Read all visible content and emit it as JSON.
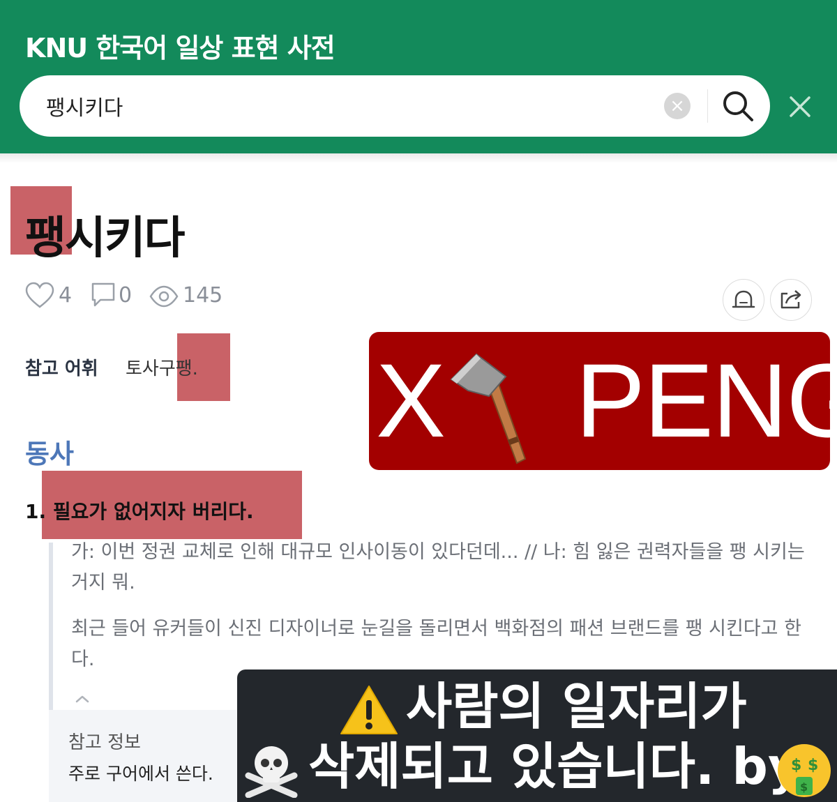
{
  "header": {
    "app_title": "KNU 한국어 일상 표현 사전",
    "search_value": "팽시키다",
    "clear_icon": "×"
  },
  "entry": {
    "word": "팽시키다",
    "likes": "4",
    "comments": "0",
    "views": "145",
    "ref_label": "참고 어휘",
    "ref_value": "토사구팽.",
    "pos": "동사",
    "sense_number": "1.",
    "sense_text": "필요가 없어지자 버리다.",
    "examples": [
      "가: 이번 정권 교체로 인해 대규모 인사이동이 있다던데... // 나: 힘 잃은 권력자들을 팽 시키는 거지 뭐.",
      "최근 들어 유커들이 신진 디자이너로 눈길을 돌리면서 백화점의 패션 브랜드를 팽 시킨다고 한다."
    ],
    "info_title": "참고 정보",
    "info_text": "주로 구어에서 쓴다."
  },
  "overlay_peng": {
    "x_text": "X",
    "peng_text": "PENG",
    "icon": "axe-icon",
    "background": "#a30000"
  },
  "overlay_warning": {
    "line1": "사람의 일자리가",
    "line2": "삭제되고 있습니다. by",
    "icons": [
      "warning-icon",
      "skull-crossbones-icon",
      "money-mouth-face-icon"
    ]
  },
  "colors": {
    "header_green": "#138a5b",
    "pos_blue": "#4d77b8",
    "highlight_red": "#c0474c"
  }
}
